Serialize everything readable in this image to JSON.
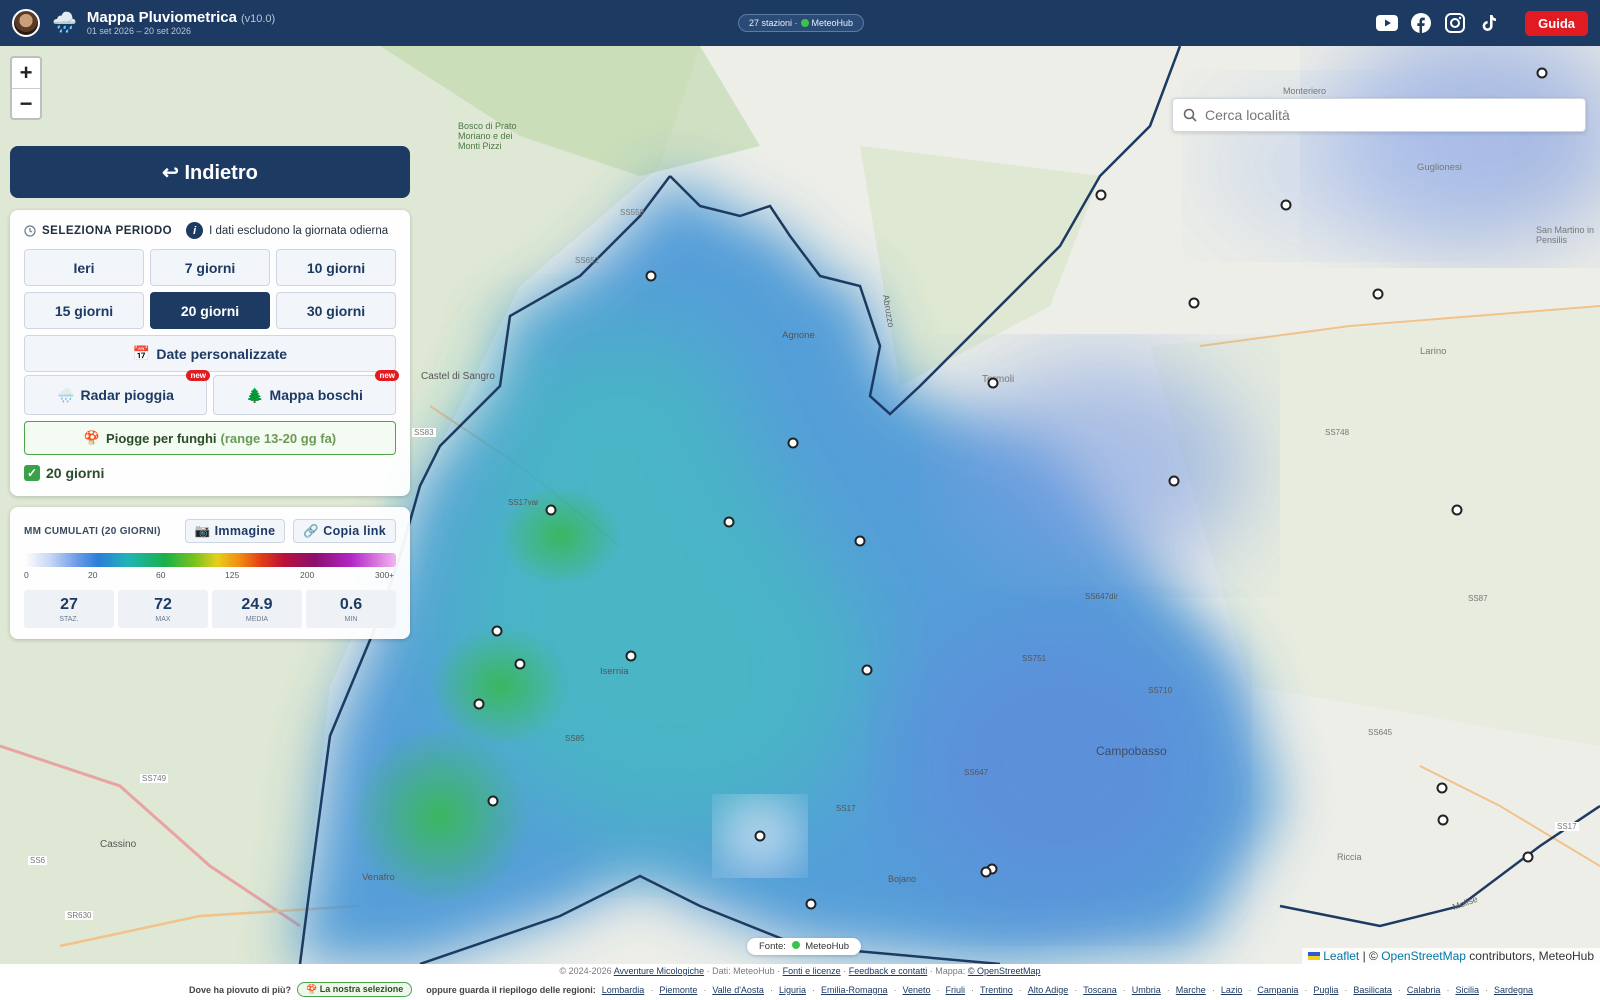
{
  "header": {
    "title": "Mappa Pluviometrica",
    "version": "(v10.0)",
    "subtitle": "01 set 2026 – 20 set 2026",
    "stations_pill_prefix": "27 stazioni ·",
    "stations_pill_source": "MeteoHub",
    "guide_label": "Guida",
    "social_icons": [
      "youtube-icon",
      "facebook-icon",
      "instagram-icon",
      "tiktok-icon"
    ]
  },
  "map": {
    "zoom_in": "+",
    "zoom_out": "−",
    "search_placeholder": "Cerca località",
    "place_labels": [
      "Monteriero",
      "Bosco di Prato Moriano e dei Monti Pizzi",
      "Castel di Sangro",
      "Agnone",
      "Abruzzo",
      "Termoli",
      "Guglionesi",
      "San Martino in Pensilis",
      "Larino",
      "Isernia",
      "Campobasso",
      "Cassino",
      "Venafro",
      "Bojano",
      "Riccia",
      "Molise"
    ],
    "road_labels": [
      "SS558",
      "SS652",
      "SS83",
      "SS17var",
      "SS85",
      "SS749",
      "SS6",
      "SR630",
      "SS747",
      "SS647",
      "SS748",
      "SS647dir",
      "SS87",
      "SS751",
      "SS710",
      "SS645",
      "SS17",
      "SS647",
      "SS645",
      "SS17",
      "SS645"
    ],
    "source_label": "Fonte:",
    "source_name": "MeteoHub",
    "attribution_leaflet": "Leaflet",
    "attribution_rest": " | © ",
    "attribution_osm": "OpenStreetMap",
    "attribution_tail": " contributors, MeteoHub"
  },
  "back_button": "↩ Indietro",
  "period": {
    "heading": "SELEZIONA PERIODO",
    "note": "I dati escludono la giornata odierna",
    "options": [
      {
        "label": "Ieri",
        "selected": false
      },
      {
        "label": "7 giorni",
        "selected": false
      },
      {
        "label": "10 giorni",
        "selected": false
      },
      {
        "label": "15 giorni",
        "selected": false
      },
      {
        "label": "20 giorni",
        "selected": true
      },
      {
        "label": "30 giorni",
        "selected": false
      }
    ],
    "custom_dates": "Date personalizzate",
    "radar": "Radar pioggia",
    "forest": "Mappa boschi",
    "new_badge": "new",
    "funghi_label": "Piogge per funghi",
    "funghi_range": "(range 13-20 gg fa)",
    "selected_status": "20 giorni"
  },
  "legend": {
    "heading": "MM CUMULATI (20 GIORNI)",
    "image_button": "Immagine",
    "copy_button": "Copia link",
    "scale_ticks": [
      "0",
      "20",
      "60",
      "125",
      "200",
      "300+"
    ],
    "stats": [
      {
        "value": "27",
        "label": "STAZ."
      },
      {
        "value": "72",
        "label": "MAX"
      },
      {
        "value": "24.9",
        "label": "MEDIA"
      },
      {
        "value": "0.6",
        "label": "MIN"
      }
    ]
  },
  "footer": {
    "copyright": "© 2024-2026",
    "site_link": "Avventure Micologiche",
    "data_text": "· Dati: MeteoHub ·",
    "sources_link": "Fonti e licenze",
    "feedback_link": "Feedback e contatti",
    "map_text": "· Mappa:",
    "osm_link": "© OpenStreetMap",
    "question": "Dove ha piovuto di più?",
    "our_selection": "La nostra selezione",
    "regions_intro": "oppure guarda il riepilogo delle regioni:",
    "regions": [
      "Lombardia",
      "Piemonte",
      "Valle d'Aosta",
      "Liguria",
      "Emilia-Romagna",
      "Veneto",
      "Friuli",
      "Trentino",
      "Alto Adige",
      "Toscana",
      "Umbria",
      "Marche",
      "Lazio",
      "Campania",
      "Puglia",
      "Basilicata",
      "Calabria",
      "Sicilia",
      "Sardegna"
    ]
  },
  "colors": {
    "brand": "#1d3a63",
    "accent_red": "#e21b23",
    "funghi_green": "#4da34a"
  }
}
